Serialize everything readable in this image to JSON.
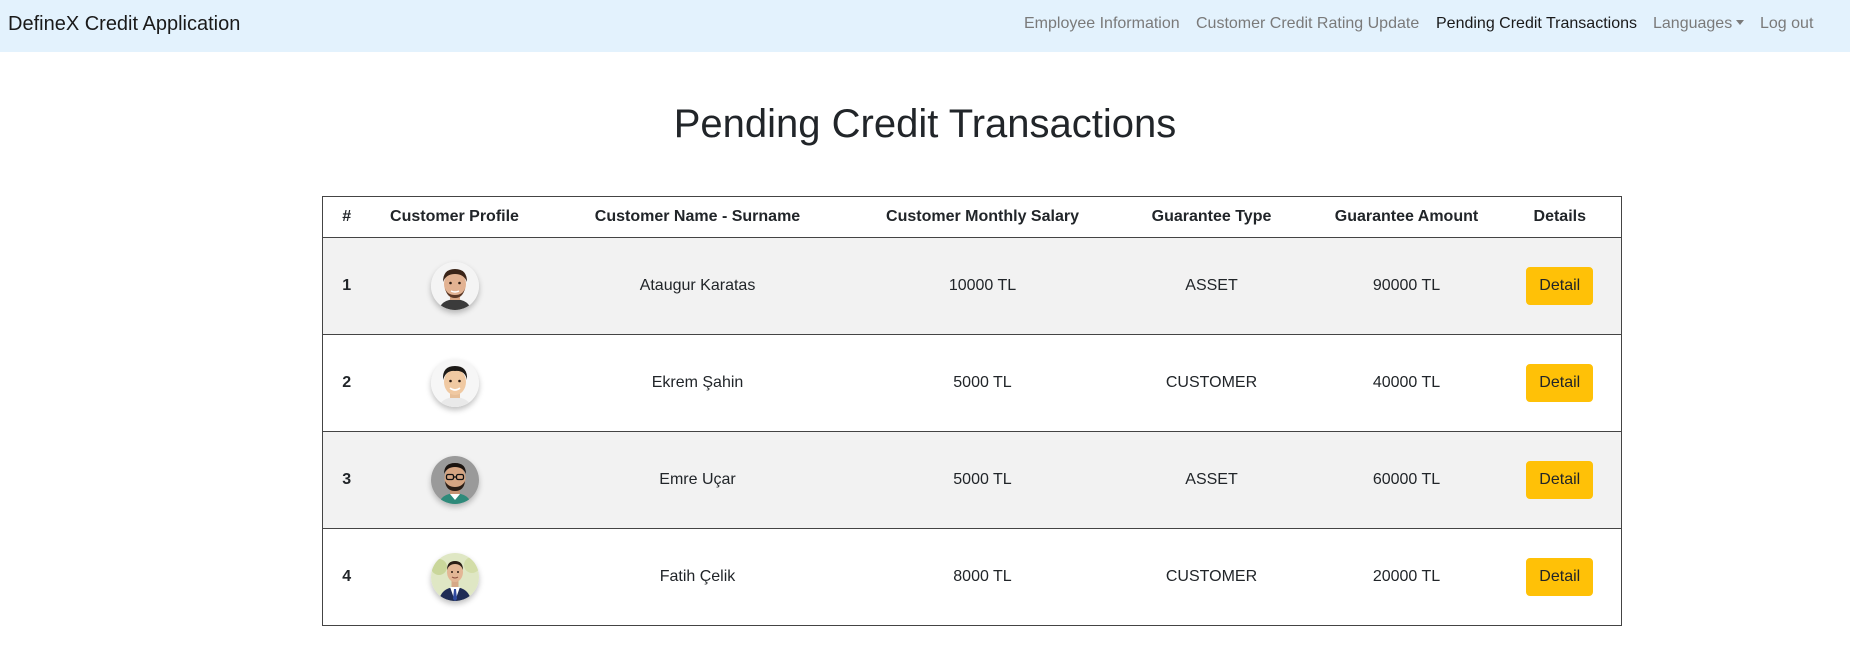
{
  "navbar": {
    "brand": "DefineX Credit Application",
    "links": {
      "employee_info": "Employee Information",
      "credit_rating_update": "Customer Credit Rating Update",
      "pending_transactions": "Pending Credit Transactions",
      "languages": "Languages",
      "logout": "Log out"
    }
  },
  "page": {
    "title": "Pending Credit Transactions"
  },
  "table": {
    "headers": {
      "index": "#",
      "profile": "Customer Profile",
      "name": "Customer Name - Surname",
      "salary": "Customer Monthly Salary",
      "guarantee_type": "Guarantee Type",
      "guarantee_amount": "Guarantee Amount",
      "details": "Details"
    },
    "rows": [
      {
        "index": "1",
        "name": "Ataugur Karatas",
        "salary": "10000 TL",
        "guarantee_type": "ASSET",
        "guarantee_amount": "90000 TL",
        "detail_label": "Detail"
      },
      {
        "index": "2",
        "name": "Ekrem Şahin",
        "salary": "5000 TL",
        "guarantee_type": "CUSTOMER",
        "guarantee_amount": "40000 TL",
        "detail_label": "Detail"
      },
      {
        "index": "3",
        "name": "Emre Uçar",
        "salary": "5000 TL",
        "guarantee_type": "ASSET",
        "guarantee_amount": "60000 TL",
        "detail_label": "Detail"
      },
      {
        "index": "4",
        "name": "Fatih Çelik",
        "salary": "8000 TL",
        "guarantee_type": "CUSTOMER",
        "guarantee_amount": "20000 TL",
        "detail_label": "Detail"
      }
    ]
  },
  "colors": {
    "navbar_bg": "#e3f2fd",
    "detail_button": "#ffc107",
    "striped_row": "#f2f2f2"
  },
  "icons": {
    "languages_dropdown": "caret-down-icon",
    "profile": "avatar-photo"
  }
}
